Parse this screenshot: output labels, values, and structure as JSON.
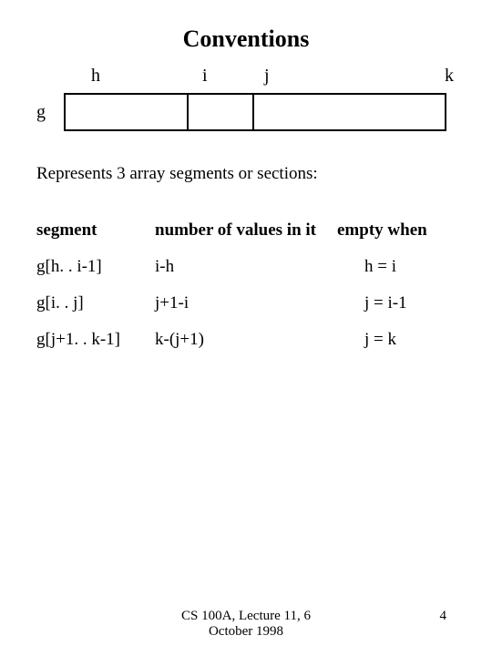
{
  "title": "Conventions",
  "diagram": {
    "h": "h",
    "i": "i",
    "j": "j",
    "k": "k",
    "g": "g"
  },
  "intro": "Represents 3 array segments or sections:",
  "headers": {
    "segment": "segment",
    "number": "number of values in it",
    "empty": "empty when"
  },
  "rows": [
    {
      "segment": "g[h. . i-1]",
      "number": "i-h",
      "empty": "h = i"
    },
    {
      "segment": "g[i. . j]",
      "number": "j+1-i",
      "empty": "j = i-1"
    },
    {
      "segment": "g[j+1. . k-1]",
      "number": "k-(j+1)",
      "empty": "j = k"
    }
  ],
  "footer": {
    "course": "CS 100A, Lecture 11, 6 October 1998",
    "page": "4"
  }
}
